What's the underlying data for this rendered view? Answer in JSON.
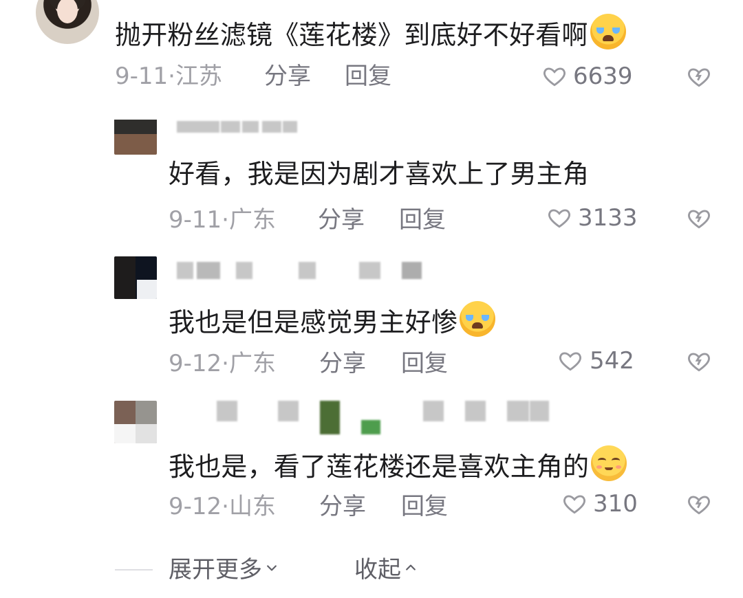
{
  "comments": [
    {
      "text": "抛开粉丝滤镜《莲花楼》到底好不好看啊",
      "emoji": "loudly-crying-face",
      "date": "9-11·",
      "region": "江苏",
      "share": "分享",
      "reply": "回复",
      "likes": "6639"
    },
    {
      "text": "好看，我是因为剧才喜欢上了男主角",
      "date": "9-11·",
      "region": "广东",
      "share": "分享",
      "reply": "回复",
      "likes": "3133"
    },
    {
      "text": "我也是但是感觉男主好惨",
      "emoji": "loudly-crying-face",
      "date": "9-12·",
      "region": "广东",
      "share": "分享",
      "reply": "回复",
      "likes": "542"
    },
    {
      "text": "我也是，看了莲花楼还是喜欢主角的",
      "emoji": "smiling-face-with-closed-eyes",
      "date": "9-12·",
      "region": "山东",
      "share": "分享",
      "reply": "回复",
      "likes": "310"
    }
  ],
  "footer": {
    "expand": "展开更多",
    "collapse": "收起"
  },
  "colors": {
    "text": "#1d1d1f",
    "meta": "#8d8d93",
    "icon": "#9a9aa0",
    "divider": "#dedee3"
  },
  "icons": {
    "like": "heart-outline-icon",
    "dislike": "broken-heart-icon",
    "expand": "chevron-down-icon",
    "collapse": "chevron-up-icon"
  }
}
